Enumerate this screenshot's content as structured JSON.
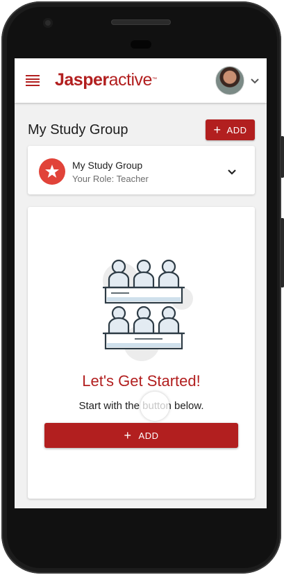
{
  "app": {
    "logo_bold": "Jasper",
    "logo_light": "active",
    "logo_tm": "™"
  },
  "header": {
    "menu_icon": "hamburger-menu-icon",
    "profile_icon": "chevron-down-icon"
  },
  "page": {
    "title": "My Study Group",
    "add_label": "ADD"
  },
  "group": {
    "name": "My Study Group",
    "role": "Your Role: Teacher",
    "icon": "star-icon",
    "expand_icon": "chevron-down-icon"
  },
  "empty_state": {
    "illustration": "classroom-icon",
    "title": "Let's Get Started!",
    "subtitle": "Start with the button below.",
    "add_label": "ADD"
  },
  "colors": {
    "brand": "#b21f1f",
    "star_badge": "#e14339",
    "background": "#f1f1f1"
  }
}
